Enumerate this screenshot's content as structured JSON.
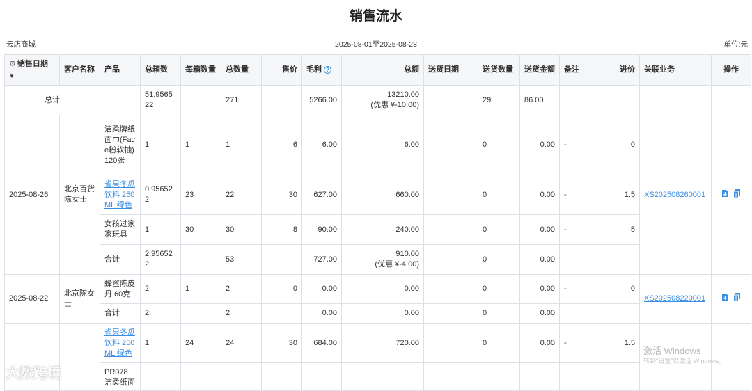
{
  "title": "销售流水",
  "store": "云店商城",
  "date_range": "2025-08-01至2025-08-28",
  "unit": "单位:元",
  "columns": {
    "date": "销售日期",
    "customer": "客户名称",
    "product": "产品",
    "boxes": "总箱数",
    "per_box": "每箱数量",
    "qty": "总数量",
    "price": "售价",
    "profit": "毛利",
    "amount": "总额",
    "ship_date": "送货日期",
    "ship_qty": "送货数量",
    "ship_amount": "送货金额",
    "remark": "备注",
    "cost": "进价",
    "related": "关联业务",
    "ops": "操作"
  },
  "total_row": {
    "label": "总计",
    "boxes": "51.956522",
    "qty": "271",
    "profit": "5266.00",
    "amount": "13210.00",
    "amount_note": "(优惠 ¥-10.00)",
    "ship_qty": "29",
    "ship_amount": "86.00"
  },
  "groups": [
    {
      "date": "2025-08-26",
      "customer": "北京百货陈女士",
      "related": "XS202508260001",
      "items": [
        {
          "product": "洁柔牌纸面巾(Face粉软抽) 120张",
          "link": false,
          "boxes": "1",
          "per_box": "1",
          "qty": "1",
          "price": "6",
          "profit": "6.00",
          "amount": "6.00",
          "ship_qty": "0",
          "ship_amount": "0.00",
          "remark": "-",
          "cost": "0"
        },
        {
          "product": "雀果冬瓜饮料 250ML 绿色",
          "link": true,
          "boxes": "0.956522",
          "per_box": "23",
          "qty": "22",
          "price": "30",
          "profit": "627.00",
          "amount": "660.00",
          "ship_qty": "0",
          "ship_amount": "0.00",
          "remark": "-",
          "cost": "1.5"
        },
        {
          "product": "女孩过家家玩具",
          "link": false,
          "boxes": "1",
          "per_box": "30",
          "qty": "30",
          "price": "8",
          "profit": "90.00",
          "amount": "240.00",
          "ship_qty": "0",
          "ship_amount": "0.00",
          "remark": "-",
          "cost": "5"
        }
      ],
      "subtotal": {
        "label": "合计",
        "boxes": "2.956522",
        "qty": "53",
        "profit": "727.00",
        "amount": "910.00",
        "amount_note": "(优惠 ¥-4.00)",
        "ship_qty": "0",
        "ship_amount": "0.00"
      }
    },
    {
      "date": "2025-08-22",
      "customer": "北京陈女士",
      "related": "XS202508220001",
      "items": [
        {
          "product": "蜂蜜陈皮丹 60克",
          "link": false,
          "boxes": "2",
          "per_box": "1",
          "qty": "2",
          "price": "0",
          "profit": "0.00",
          "amount": "0.00",
          "ship_qty": "0",
          "ship_amount": "0.00",
          "remark": "-",
          "cost": "0"
        }
      ],
      "subtotal": {
        "label": "合计",
        "boxes": "2",
        "qty": "2",
        "profit": "0.00",
        "amount": "0.00",
        "ship_qty": "0",
        "ship_amount": "0.00"
      }
    },
    {
      "items": [
        {
          "product": "雀果冬瓜饮料 250ML 绿色",
          "link": true,
          "boxes": "1",
          "per_box": "24",
          "qty": "24",
          "price": "30",
          "profit": "684.00",
          "amount": "720.00",
          "ship_qty": "0",
          "ship_amount": "0.00",
          "remark": "-",
          "cost": "1.5"
        },
        {
          "product": "PR078 洁柔纸面"
        }
      ]
    }
  ],
  "watermarks": {
    "windows": "激活 Windows",
    "windows_sub": "转到\"设置\"以激活 Windows。",
    "brand": "大数跨境"
  },
  "colors": {
    "link": "#3a8ee6",
    "header_bg": "#f5f6f8",
    "border": "#dcdfe6"
  }
}
